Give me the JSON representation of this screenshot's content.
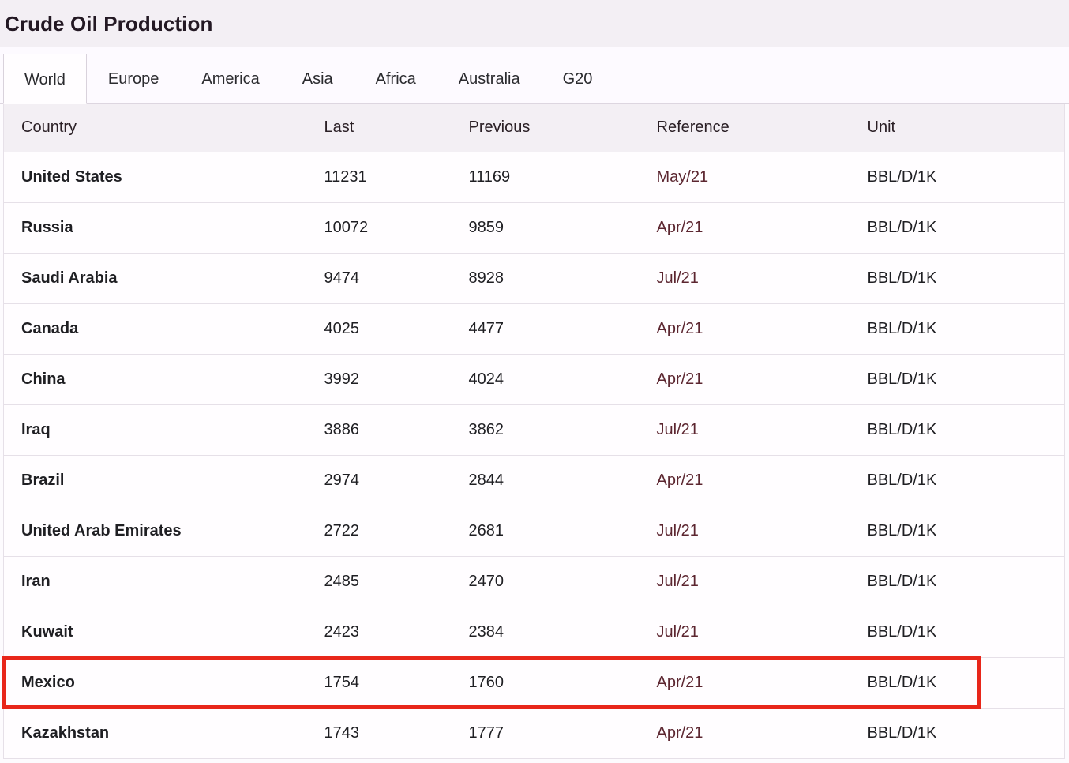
{
  "header": {
    "title": "Crude Oil Production"
  },
  "tabs": [
    {
      "label": "World",
      "active": true
    },
    {
      "label": "Europe",
      "active": false
    },
    {
      "label": "America",
      "active": false
    },
    {
      "label": "Asia",
      "active": false
    },
    {
      "label": "Africa",
      "active": false
    },
    {
      "label": "Australia",
      "active": false
    },
    {
      "label": "G20",
      "active": false
    }
  ],
  "table": {
    "columns": [
      "Country",
      "Last",
      "Previous",
      "Reference",
      "Unit"
    ],
    "rows": [
      {
        "country": "United States",
        "last": "11231",
        "previous": "11169",
        "reference": "May/21",
        "unit": "BBL/D/1K",
        "highlighted": false
      },
      {
        "country": "Russia",
        "last": "10072",
        "previous": "9859",
        "reference": "Apr/21",
        "unit": "BBL/D/1K",
        "highlighted": false
      },
      {
        "country": "Saudi Arabia",
        "last": "9474",
        "previous": "8928",
        "reference": "Jul/21",
        "unit": "BBL/D/1K",
        "highlighted": false
      },
      {
        "country": "Canada",
        "last": "4025",
        "previous": "4477",
        "reference": "Apr/21",
        "unit": "BBL/D/1K",
        "highlighted": false
      },
      {
        "country": "China",
        "last": "3992",
        "previous": "4024",
        "reference": "Apr/21",
        "unit": "BBL/D/1K",
        "highlighted": false
      },
      {
        "country": "Iraq",
        "last": "3886",
        "previous": "3862",
        "reference": "Jul/21",
        "unit": "BBL/D/1K",
        "highlighted": false
      },
      {
        "country": "Brazil",
        "last": "2974",
        "previous": "2844",
        "reference": "Apr/21",
        "unit": "BBL/D/1K",
        "highlighted": false
      },
      {
        "country": "United Arab Emirates",
        "last": "2722",
        "previous": "2681",
        "reference": "Jul/21",
        "unit": "BBL/D/1K",
        "highlighted": false
      },
      {
        "country": "Iran",
        "last": "2485",
        "previous": "2470",
        "reference": "Jul/21",
        "unit": "BBL/D/1K",
        "highlighted": false
      },
      {
        "country": "Kuwait",
        "last": "2423",
        "previous": "2384",
        "reference": "Jul/21",
        "unit": "BBL/D/1K",
        "highlighted": false
      },
      {
        "country": "Mexico",
        "last": "1754",
        "previous": "1760",
        "reference": "Apr/21",
        "unit": "BBL/D/1K",
        "highlighted": true
      },
      {
        "country": "Kazakhstan",
        "last": "1743",
        "previous": "1777",
        "reference": "Apr/21",
        "unit": "BBL/D/1K",
        "highlighted": false
      }
    ]
  },
  "colors": {
    "title_band": "#f3eff4",
    "header_row": "#f3eff4",
    "highlight_border": "#e8261a",
    "reference_text": "#5c2630",
    "row_border": "#e6e0e8"
  }
}
